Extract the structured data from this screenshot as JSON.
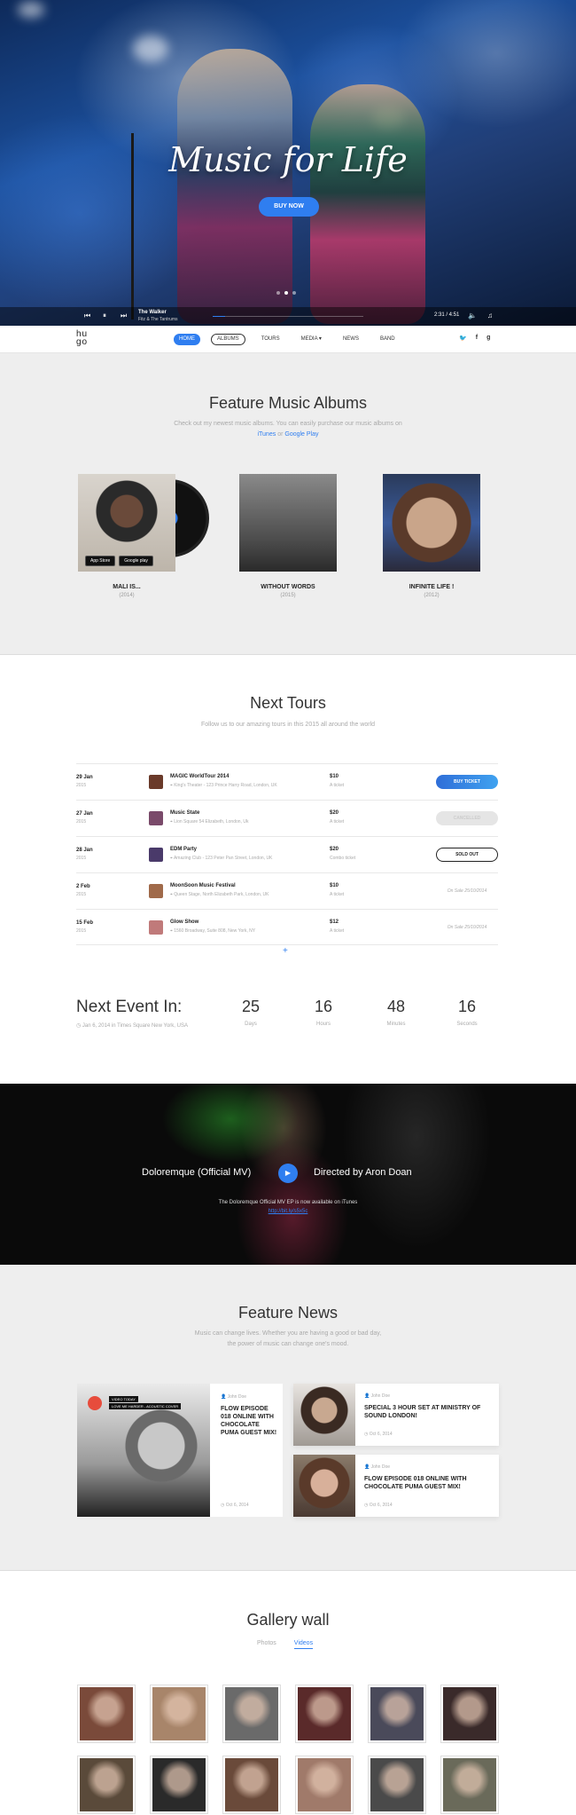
{
  "hero": {
    "title": "Music for Life",
    "button_label": "BUY NOW",
    "player": {
      "track_title": "The Walker",
      "track_artist": "Fitz & The Tantrums",
      "time": "2:31 / 4:51",
      "progress": 0.08
    }
  },
  "nav": {
    "logo_top": "hu",
    "logo_bottom": "go",
    "items": [
      "HOME",
      "ALBUMS",
      "TOURS",
      "MEDIA",
      "NEWS",
      "BAND"
    ],
    "social": [
      "twitter-icon",
      "facebook-icon",
      "google-plus-icon"
    ]
  },
  "albums": {
    "title": "Feature Music Albums",
    "subtitle": "Check out my newest music albums. You can easily purchase our music albums on",
    "link_itunes": "iTunes",
    "link_or": "or",
    "link_google": "Google Play",
    "list": [
      {
        "name": "MALI IS...",
        "year": "(2014)",
        "cover": "#8a8a8a"
      },
      {
        "name": "WITHOUT WORDS",
        "year": "(2015)",
        "cover": "#5a5a5a"
      },
      {
        "name": "INFINITE LIFE !",
        "year": "(2012)",
        "cover": "#3a5a9a"
      }
    ],
    "badge_appstore": "App Store",
    "badge_google": "Google play"
  },
  "tours": {
    "title": "Next Tours",
    "subtitle": "Follow us to our amazing tours in this 2015 all around the world",
    "rows": [
      {
        "date": "29 Jan",
        "year": "2015",
        "name": "MAGIC WorldTour 2014",
        "venue": "King's Theater - 123 Prince Harry Road, London, UK",
        "price": "$10",
        "ticket": "A ticket",
        "action": "BUY TICKET",
        "state": "buy",
        "thumb": "#6a3a2a"
      },
      {
        "date": "27 Jan",
        "year": "2015",
        "name": "Music State",
        "venue": "Lion Square 54 Elizabeth, London, Uk",
        "price": "$20",
        "ticket": "A ticket",
        "action": "CANCELLED",
        "state": "disabled",
        "thumb": "#7a4a6a"
      },
      {
        "date": "28 Jan",
        "year": "2015",
        "name": "EDM Party",
        "venue": "Amazing Club - 123 Peter Pan Street, London, UK",
        "price": "$20",
        "ticket": "Combo ticket",
        "action": "SOLD OUT",
        "state": "sold",
        "thumb": "#4a3a6a"
      },
      {
        "date": "2 Feb",
        "year": "2015",
        "name": "MoonSoon Music Festival",
        "venue": "Queen Stage, North Elizabeth Park, London, UK",
        "price": "$10",
        "ticket": "A ticket",
        "action": "On Sale 25/10/2014",
        "state": "onsale",
        "thumb": "#a06a4a"
      },
      {
        "date": "15 Feb",
        "year": "2015",
        "name": "Glow Show",
        "venue": "1560 Broadway, Suite 808, New York, NY",
        "price": "$12",
        "ticket": "A ticket",
        "action": "On Sale 25/10/2014",
        "state": "onsale",
        "thumb": "#c07a7a"
      }
    ]
  },
  "next_event": {
    "title": "Next Event In:",
    "where": "Jan 6, 2014 in Times Square New York, USA",
    "countdown": [
      {
        "value": "25",
        "label": "Days"
      },
      {
        "value": "16",
        "label": "Hours"
      },
      {
        "value": "48",
        "label": "Minutes"
      },
      {
        "value": "16",
        "label": "Seconds"
      }
    ]
  },
  "video": {
    "left_text": "Doloremque (Official MV)",
    "right_text": "Directed by Aron Doan",
    "note": "The Doloremque Official MV EP is now available on iTunes",
    "link": "http://bit.ly/s5x5c"
  },
  "news": {
    "title": "Feature News",
    "subtitle_1": "Music can change lives. Whether you are having a good or bad day,",
    "subtitle_2": "the power of music can change one's mood.",
    "featured": {
      "author": "John Doe",
      "headline": "FLOW EPISODE 018 ONLINE WITH CHOCOLATE PUMA GUEST MIX!",
      "date": "Oct 6, 2014",
      "rec_tag": "VIDEO TODAY",
      "rec_title": "LOVE ME HARDER - ACOUSTIC COVER"
    },
    "side": [
      {
        "author": "John Doe",
        "headline": "SPECIAL 3 HOUR SET AT MINISTRY OF SOUND LONDON!",
        "date": "Oct 6, 2014",
        "thumb": "#5a4a42"
      },
      {
        "author": "John Doe",
        "headline": "FLOW EPISODE 018 ONLINE WITH CHOCOLATE PUMA GUEST MIX!",
        "date": "Oct 6, 2014",
        "thumb": "#8a6a5a"
      }
    ]
  },
  "gallery": {
    "title": "Gallery wall",
    "tabs": [
      "Photos",
      "Videos"
    ],
    "active_tab": "Videos",
    "items": [
      "#7a4a3a",
      "#a8856a",
      "#6a6a6a",
      "#5a2a2a",
      "#4a4a5a",
      "#3a2a2a",
      "#5a4a3a",
      "#2a2a2a",
      "#6a4a3a",
      "#a07a6a",
      "#4a4a4a",
      "#6a6a5a"
    ]
  },
  "colors": {
    "accent": "#2f7ef0",
    "background_grey": "#eeeeee"
  }
}
